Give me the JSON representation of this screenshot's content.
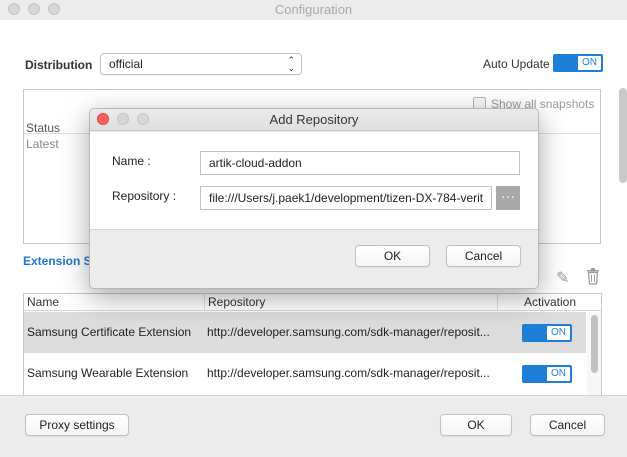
{
  "window": {
    "title": "Configuration"
  },
  "distribution": {
    "label": "Distribution",
    "selected": "official"
  },
  "auto_update": {
    "label": "Auto Update",
    "state": "ON"
  },
  "snapshots": {
    "show_all_label": "Show all snapshots",
    "status_header": "Status",
    "latest": "Latest"
  },
  "extensions": {
    "section_label": "Extension SD",
    "columns": {
      "name": "Name",
      "repository": "Repository",
      "activation": "Activation"
    },
    "rows": [
      {
        "name": "Samsung Certificate Extension",
        "repository": "http://developer.samsung.com/sdk-manager/reposit...",
        "activation": "ON"
      },
      {
        "name": "Samsung Wearable Extension",
        "repository": "http://developer.samsung.com/sdk-manager/reposit...",
        "activation": "ON"
      }
    ]
  },
  "footer": {
    "proxy_label": "Proxy settings",
    "ok_label": "OK",
    "cancel_label": "Cancel"
  },
  "dialog": {
    "title": "Add Repository",
    "name_label": "Name :",
    "name_value": "artik-cloud-addon",
    "repo_label": "Repository :",
    "repo_value": "file:///Users/j.paek1/development/tizen-DX-784-verit",
    "more_label": "···",
    "ok_label": "OK",
    "cancel_label": "Cancel"
  },
  "colors": {
    "accent": "#1e7fd8",
    "close": "#fc605b",
    "section_link": "#1b7ad0"
  }
}
